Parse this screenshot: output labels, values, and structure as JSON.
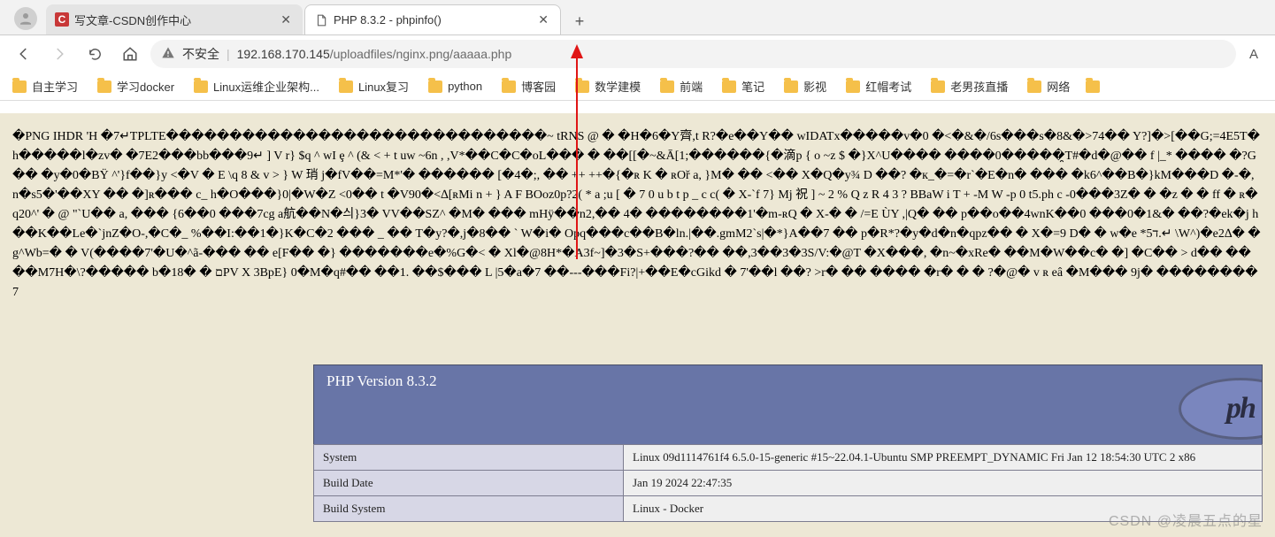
{
  "tabs": [
    {
      "title": "写文章-CSDN创作中心",
      "favicon": "csdn",
      "active": false
    },
    {
      "title": "PHP 8.3.2 - phpinfo()",
      "favicon": "page",
      "active": true
    }
  ],
  "address": {
    "security_label": "不安全",
    "url_host": "192.168.170.145",
    "url_path": "/uploadfiles/nginx.png/aaaaa.php"
  },
  "right_indicator": "A",
  "bookmarks": [
    {
      "label": "自主学习"
    },
    {
      "label": "学习docker"
    },
    {
      "label": "Linux运维企业架构..."
    },
    {
      "label": "Linux复习"
    },
    {
      "label": "python"
    },
    {
      "label": "博客园"
    },
    {
      "label": "数学建模"
    },
    {
      "label": "前端"
    },
    {
      "label": "笔记"
    },
    {
      "label": "影视"
    },
    {
      "label": "红帽考试"
    },
    {
      "label": "老男孩直播"
    },
    {
      "label": "网络"
    }
  ],
  "raw_png_text": "�PNG  IHDR  'H   �7↵TPLTE������������������������������~  tRNS @ � �H�6�Y齊,t R?�e��Y�� wIDATx�����v�0 �<�&�/6s���s�8&�>74�� Y?]�>[��G;=4E5T�h�����l�zv� �7E2���bb���9↵ ] V r} $q ^ wI ȩ ^ (& < + t uw ~6n , ,V*��C�C�oL��� � ��[[�~&Ā[1;������{�滴p { o ~z $ �}X^U���� ����0�����̯T#�d�@�� f |_* ���� �?G�� �y�0�BŸ ^'}f��}y <�V � E \\q 8 & v > } W 琑 j�fV��=M*'� ������ [�4�;, �� ++ ++�{�ʀ K � ʀOř a, }M� �� <�� X�Q�y¾ D ��? �к_�=�r`�E�n� ��� �k6^��B�}kM���D �-�, n�s5�'��XY �� �]ʀ��� c_ h�O���}0|�W�Z <0�� t �V90�<∆[ʀMi n + } A F BOoz0p?2( * a ;u [ � 7 0 u b t p _ c c( � X-`f 7} Mj 祝 ] ~ 2 % Q z R 4 3 ? BBaW i T + -M W -p 0 t5.ph c -0���3Z� � �z � � ff � ʀ�q20^' � @ \"`U�� a, ��� {6��0 ���7cg a航��N�싀}3� VV��SZ^ �M� ��� mHÿ��n2,�� 4� ��������1'�m-ʀQ � X-� � /=E ÙY ,|Q� �� p��o��4wnK��0 ���0�1&� ��?�ek�j h��K��Le�`jnZ�O-,�C�_ %��I:��1�}K�C�2 ��� _ �� T�y?�,j�8�� ` W�i� Opq���c��B�ln.|��.gmM2`s|�*}A��7 �� p�R*?�y�d�n�qpz�� � X�=9 D� � w�e *5ד.↵ \\W^)�e2∆� �g^Wb=� � V(����7'�U�^ã-��� �� e[F�� �} �������e�%G�< � Xl�@8H*�A3f~]�3�S+���?�� ��,3��3�3S/V:�@T �X���, �n~�xRe� ��M�W��c� �] �C�� > d�� ����M7H�\\?����� b�1ם � �8PV X 3BpE} 0�M�q#�� ��1. ��$��� L |5�a�7 ��---���Fi?|+��E�cGikd � 7'��l ��? >r� �� ���� �r� � � ?�@� v ʀ eâ �M��� 9j� ��������7",
  "php": {
    "version_label": "PHP Version 8.3.2",
    "logo_text": "ph",
    "rows": [
      {
        "key": "System",
        "value": "Linux 09d1114761f4 6.5.0-15-generic #15~22.04.1-Ubuntu SMP PREEMPT_DYNAMIC Fri Jan 12 18:54:30 UTC 2 x86"
      },
      {
        "key": "Build Date",
        "value": "Jan 19 2024 22:47:35"
      },
      {
        "key": "Build System",
        "value": "Linux - Docker"
      }
    ]
  },
  "watermark": "CSDN @凌晨五点的星"
}
